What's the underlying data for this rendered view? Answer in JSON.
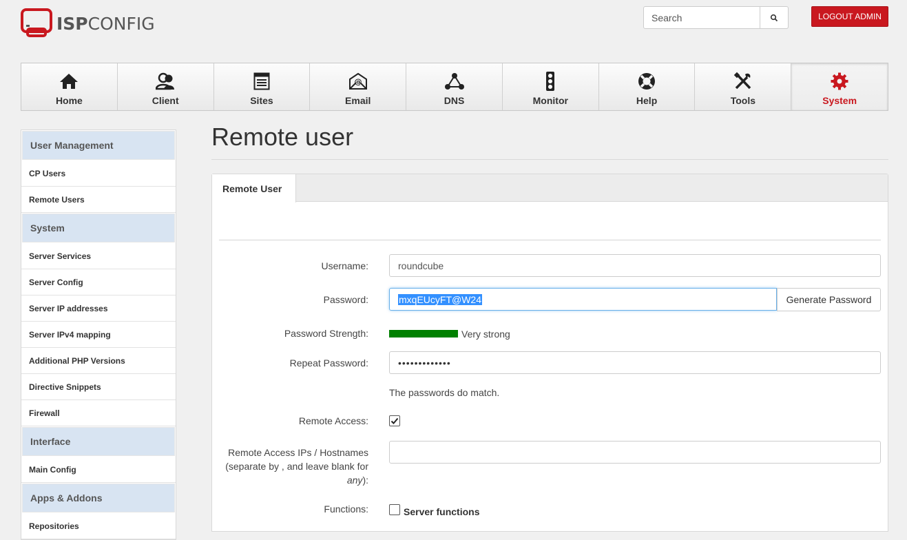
{
  "app": {
    "logo_text_bold": "ISP",
    "logo_text_rest": "CONFIG"
  },
  "header": {
    "search_placeholder": "Search",
    "search_icon": "search-icon",
    "logout_label": "LOGOUT ADMIN"
  },
  "topnav": {
    "items": [
      {
        "label": "Home",
        "icon": "home-icon"
      },
      {
        "label": "Client",
        "icon": "client-icon"
      },
      {
        "label": "Sites",
        "icon": "sites-icon"
      },
      {
        "label": "Email",
        "icon": "email-icon"
      },
      {
        "label": "DNS",
        "icon": "dns-icon"
      },
      {
        "label": "Monitor",
        "icon": "monitor-icon"
      },
      {
        "label": "Help",
        "icon": "help-icon"
      },
      {
        "label": "Tools",
        "icon": "tools-icon"
      },
      {
        "label": "System",
        "icon": "gear-icon",
        "active": true
      }
    ]
  },
  "sidebar": {
    "sections": [
      {
        "title": "User Management",
        "items": [
          "CP Users",
          "Remote Users"
        ]
      },
      {
        "title": "System",
        "items": [
          "Server Services",
          "Server Config",
          "Server IP addresses",
          "Server IPv4 mapping",
          "Additional PHP Versions",
          "Directive Snippets",
          "Firewall"
        ]
      },
      {
        "title": "Interface",
        "items": [
          "Main Config"
        ]
      },
      {
        "title": "Apps & Addons",
        "items": [
          "Repositories"
        ]
      }
    ]
  },
  "main": {
    "page_title": "Remote user",
    "tab_label": "Remote User",
    "form": {
      "username_label": "Username:",
      "username_value": "roundcube",
      "password_label": "Password:",
      "password_value": "mxqEUcyFT@W24",
      "generate_label": "Generate Password",
      "strength_label": "Password Strength:",
      "strength_text": "Very strong",
      "strength_level": 1.0,
      "strength_color": "#008000",
      "repeat_label": "Repeat Password:",
      "repeat_value": "•••••••••••••",
      "match_text": "The passwords do match.",
      "remote_access_label": "Remote Access:",
      "remote_access_checked": true,
      "ips_label_line1": "Remote Access IPs / Hostnames",
      "ips_label_line2": "(separate by , and leave blank for",
      "ips_label_any": "any",
      "ips_label_end": "):",
      "ips_value": "",
      "functions_label": "Functions:",
      "functions_item": "Server functions",
      "functions_checked": false
    }
  },
  "colors": {
    "brand_red": "#c9181f",
    "sidebar_head_bg": "#d8e4f2",
    "focus_blue": "#66afe9"
  }
}
